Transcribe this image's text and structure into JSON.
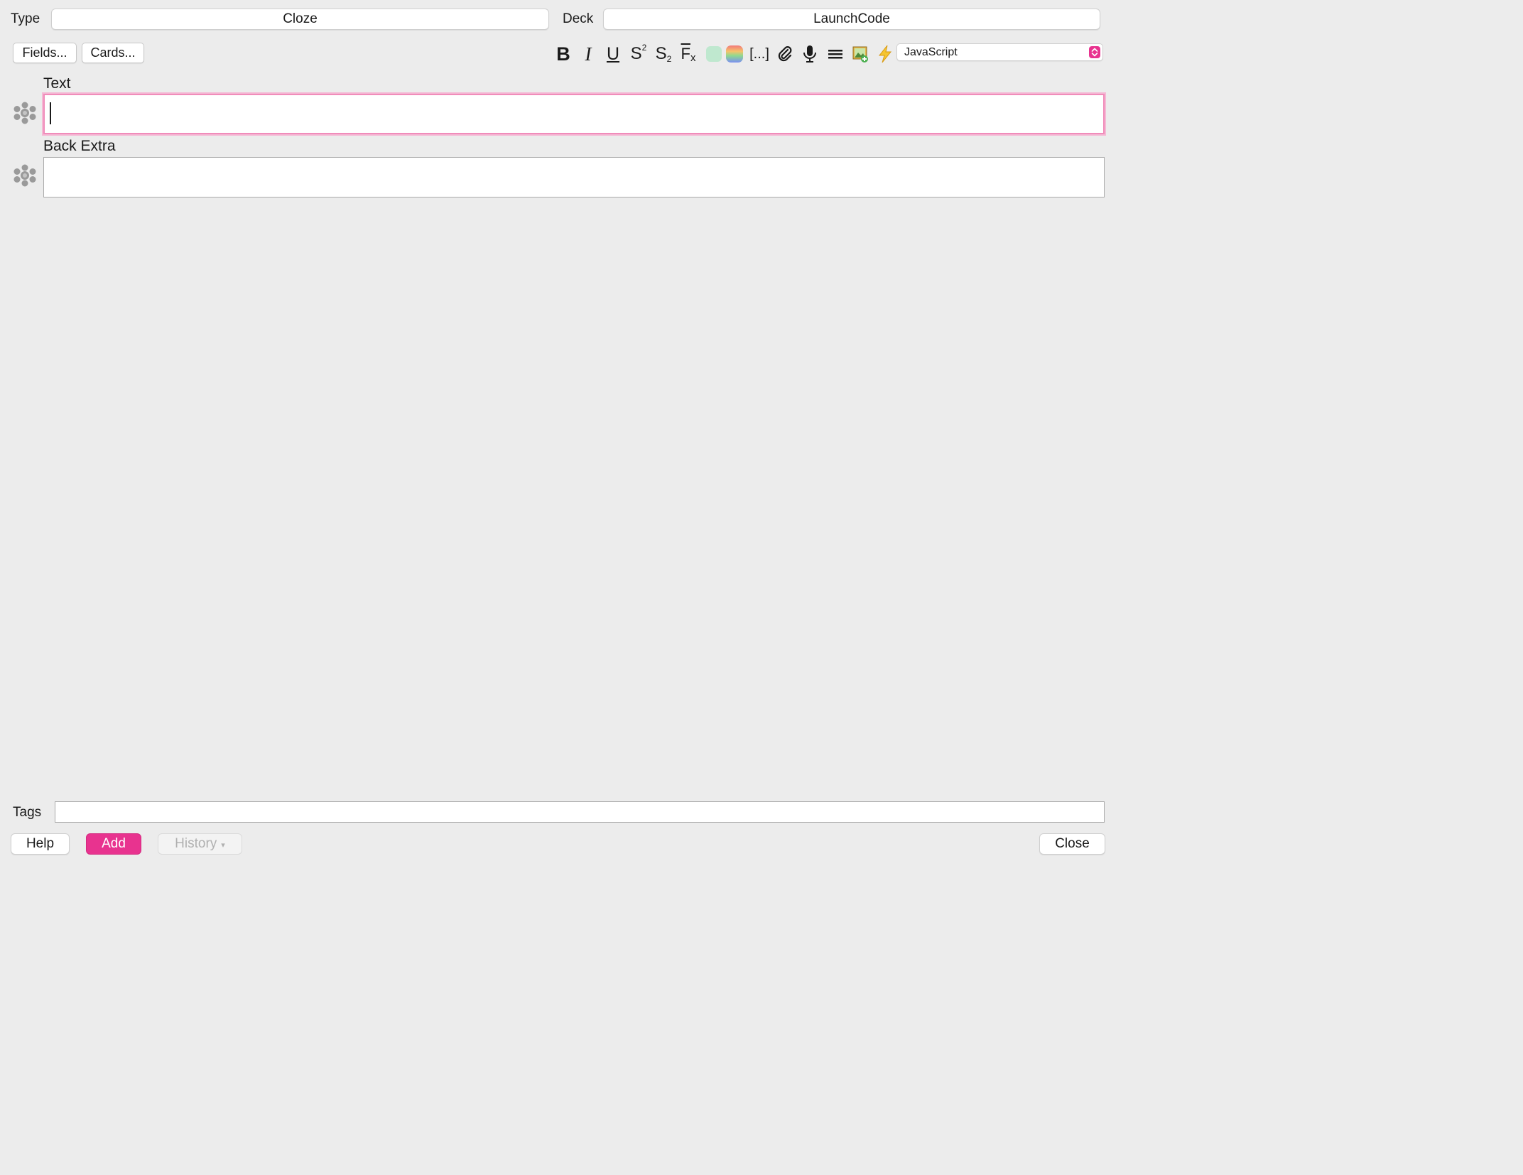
{
  "header": {
    "type_label": "Type",
    "type_value": "Cloze",
    "deck_label": "Deck",
    "deck_value": "LaunchCode"
  },
  "toolbar": {
    "fields_button": "Fields...",
    "cards_button": "Cards...",
    "bold": "B",
    "italic": "I",
    "underline": "U",
    "superscript_base": "S",
    "superscript_mark": "2",
    "subscript_base": "S",
    "subscript_mark": "2",
    "clear_base": "F",
    "clear_mark": "x",
    "cloze": "[...]",
    "language_select_value": "JavaScript",
    "text_color": "#bfe8cf",
    "accent_color": "#e8338f"
  },
  "fields": [
    {
      "label": "Text",
      "value": "",
      "focused": true
    },
    {
      "label": "Back Extra",
      "value": "",
      "focused": false
    }
  ],
  "tags": {
    "label": "Tags",
    "value": ""
  },
  "footer": {
    "help_button": "Help",
    "add_button": "Add",
    "history_button": "History",
    "history_caret": "▾",
    "close_button": "Close"
  }
}
